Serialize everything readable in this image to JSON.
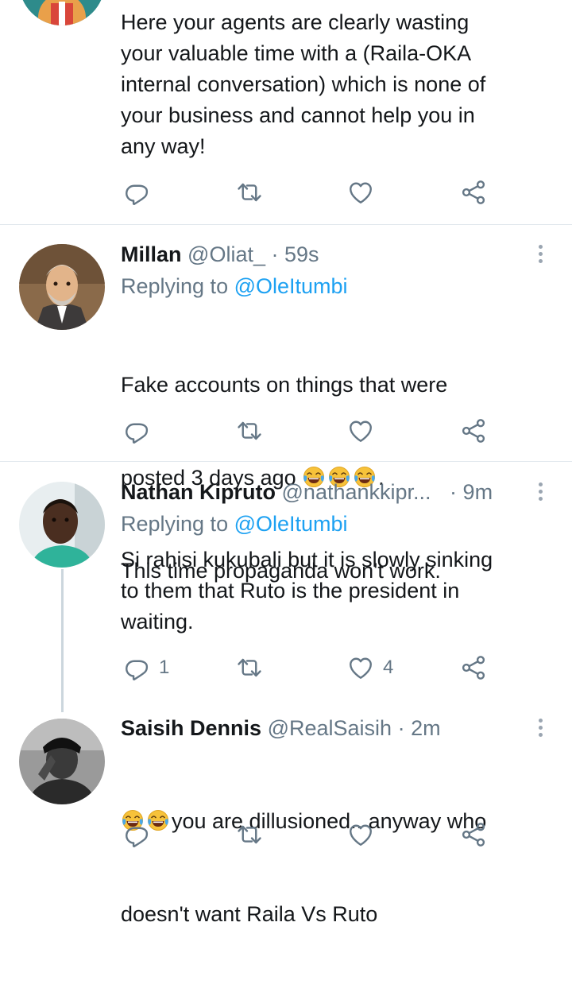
{
  "tweets": [
    {
      "text": "Here your agents are clearly wasting\nyour valuable time with a (Raila-OKA\ninternal conversation) which is none of\nyour business and cannot help you in\nany way!",
      "replies": "",
      "likes": ""
    },
    {
      "name": "Millan",
      "handle": "@Oliat_",
      "dot": " · ",
      "time": "59s",
      "replying_prefix": "Replying to ",
      "replying_to": "@OleItumbi",
      "text_line1": "Fake accounts on things that were",
      "text_line2_pre": "posted 3 days ago ",
      "text_line2_post": ".",
      "text_line3": "This time propaganda won't work.",
      "replies": "",
      "likes": ""
    },
    {
      "name": "Nathan Kipruto",
      "handle": "@nathankkipr...",
      "dot": " · ",
      "time": "9m",
      "replying_prefix": "Replying to ",
      "replying_to": "@OleItumbi",
      "text": "Si rahisi kukubali but it is slowly sinking\nto them that Ruto is the president in\nwaiting.",
      "replies": "1",
      "likes": "4"
    },
    {
      "name": "Saisih Dennis",
      "handle": "@RealSaisih",
      "dot": " · ",
      "time": "2m",
      "text_line1_post": "you are dillusioned.. anyway who",
      "text_line2": "doesn't want Raila Vs Ruto"
    }
  ],
  "icons": {
    "reply": "reply-icon",
    "retweet": "retweet-icon",
    "like": "heart-icon",
    "share": "share-icon",
    "more": "more-vertical-icon",
    "emoji": "face-with-tears-of-joy-emoji"
  },
  "colors": {
    "link": "#1da1f2",
    "secondary_text": "#657786",
    "divider": "#e1e8ed"
  }
}
